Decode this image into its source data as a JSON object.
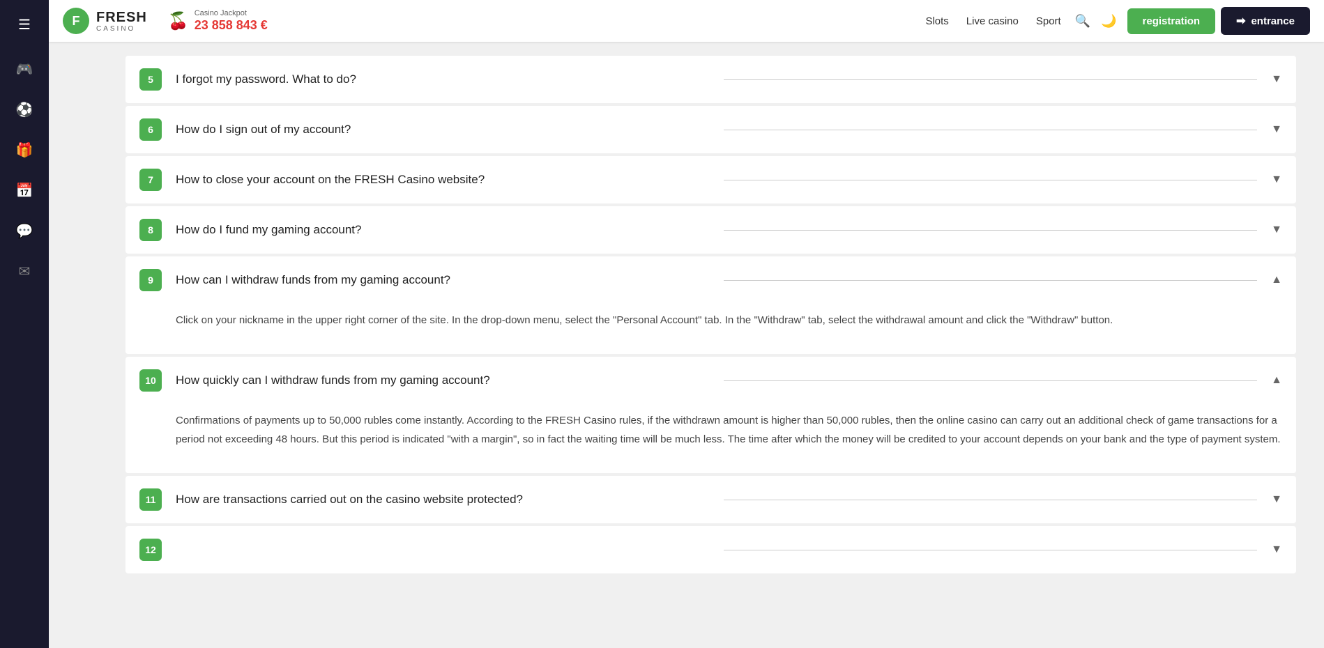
{
  "header": {
    "logo": {
      "badge": "F",
      "fresh": "FRESH",
      "casino": "CASINO"
    },
    "jackpot": {
      "label": "Casino Jackpot",
      "amount": "23 858 843 €"
    },
    "nav": {
      "slots": "Slots",
      "live_casino": "Live casino",
      "sport": "Sport"
    },
    "buttons": {
      "registration": "registration",
      "entrance": "entrance"
    }
  },
  "sidebar": {
    "items": [
      {
        "icon": "☰",
        "name": "hamburger-menu"
      },
      {
        "icon": "🎮",
        "name": "games-icon"
      },
      {
        "icon": "⚽",
        "name": "sports-icon"
      },
      {
        "icon": "🎁",
        "name": "bonuses-icon"
      },
      {
        "icon": "📅",
        "name": "calendar-icon"
      },
      {
        "icon": "💬",
        "name": "chat-icon"
      },
      {
        "icon": "✉",
        "name": "messages-icon"
      }
    ]
  },
  "faq": {
    "items": [
      {
        "number": "5",
        "question": "I forgot my password. What to do?",
        "expanded": false,
        "body": ""
      },
      {
        "number": "6",
        "question": "How do I sign out of my account?",
        "expanded": false,
        "body": ""
      },
      {
        "number": "7",
        "question": "How to close your account on the FRESH Casino website?",
        "expanded": false,
        "body": ""
      },
      {
        "number": "8",
        "question": "How do I fund my gaming account?",
        "expanded": false,
        "body": ""
      },
      {
        "number": "9",
        "question": "How can I withdraw funds from my gaming account?",
        "expanded": true,
        "body": "Click on your nickname in the upper right corner of the site. In the drop-down menu, select the \"Personal Account\" tab. In the \"Withdraw\" tab, select the withdrawal amount and click the \"Withdraw\" button."
      },
      {
        "number": "10",
        "question": "How quickly can I withdraw funds from my gaming account?",
        "expanded": true,
        "body": "Confirmations of payments up to 50,000 rubles come instantly. According to the FRESH Casino rules, if the withdrawn amount is higher than 50,000 rubles, then the online casino can carry out an additional check of game transactions for a period not exceeding 48 hours. But this period is indicated \"with a margin\", so in fact the waiting time will be much less. The time after which the money will be credited to your account depends on your bank and the type of payment system."
      },
      {
        "number": "11",
        "question": "How are transactions carried out on the casino website protected?",
        "expanded": false,
        "body": ""
      },
      {
        "number": "12",
        "question": "",
        "expanded": false,
        "body": ""
      }
    ]
  }
}
